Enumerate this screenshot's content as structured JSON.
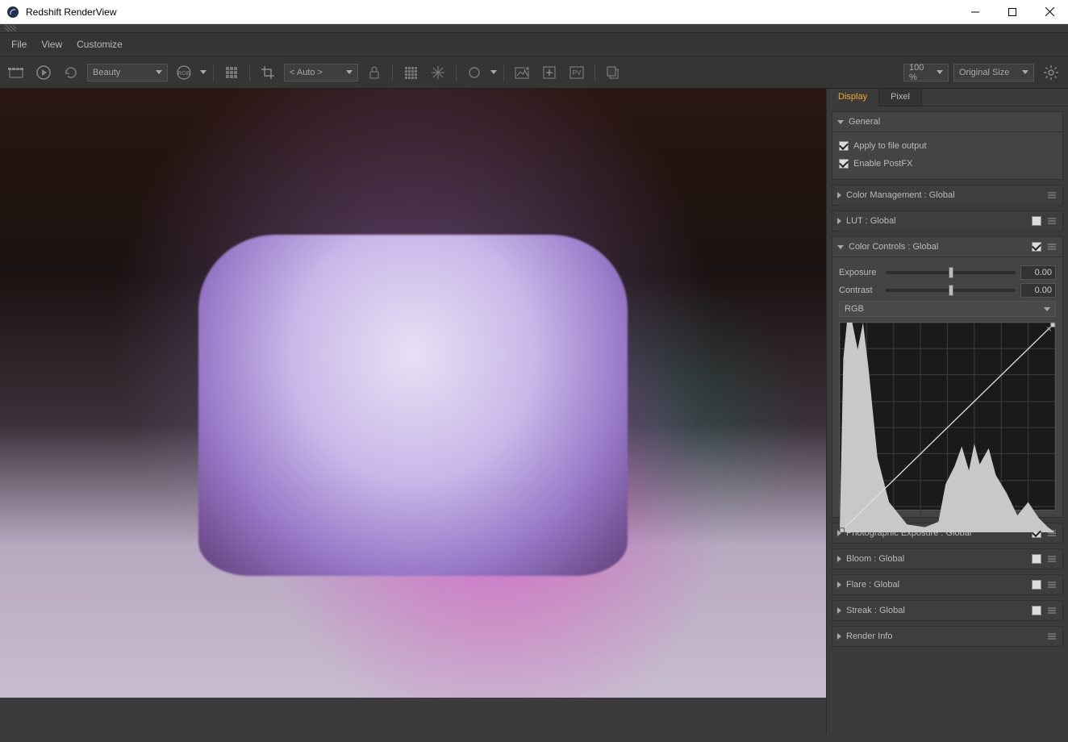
{
  "window": {
    "title": "Redshift RenderView"
  },
  "menu": {
    "file": "File",
    "view": "View",
    "customize": "Customize"
  },
  "toolbar": {
    "aov_selected": "Beauty",
    "crop_auto": "< Auto >",
    "zoom": "100 %",
    "size_mode": "Original Size"
  },
  "tabs": {
    "display": "Display",
    "pixel": "Pixel"
  },
  "general": {
    "label": "General",
    "apply_to_file_output": "Apply to file output",
    "enable_postfx": "Enable PostFX"
  },
  "sections": {
    "color_mgmt": "Color Management  : Global",
    "lut": "LUT  : Global",
    "color_controls": "Color Controls  : Global",
    "photo_exposure": "Photographic Exposure  : Global",
    "bloom": "Bloom  : Global",
    "flare": "Flare  : Global",
    "streak": "Streak  : Global",
    "render_info": "Render Info"
  },
  "controls": {
    "exposure_label": "Exposure",
    "exposure_value": "0.00",
    "contrast_label": "Contrast",
    "contrast_value": "0.00",
    "histogram_mode": "RGB"
  }
}
